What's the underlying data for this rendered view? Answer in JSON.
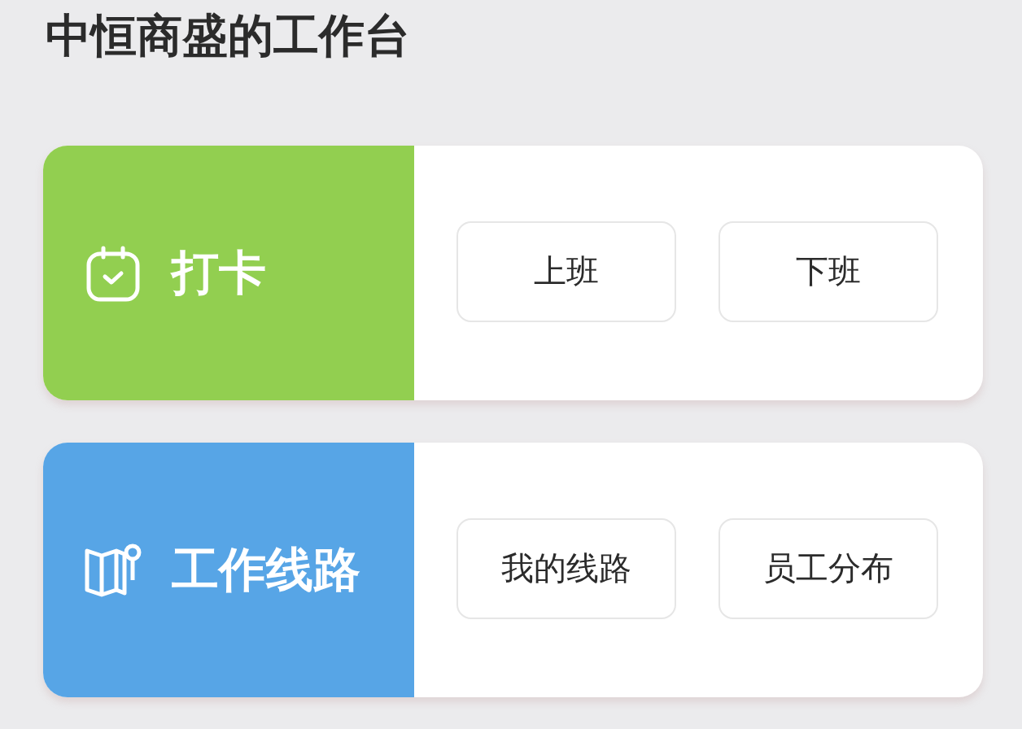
{
  "title": "中恒商盛的工作台",
  "cards": [
    {
      "kind": "calendar",
      "label": "打卡",
      "color": "#92cf50",
      "buttons": [
        "上班",
        "下班"
      ]
    },
    {
      "kind": "map",
      "label": "工作线路",
      "color": "#57a5e6",
      "buttons": [
        "我的线路",
        "员工分布"
      ]
    }
  ]
}
